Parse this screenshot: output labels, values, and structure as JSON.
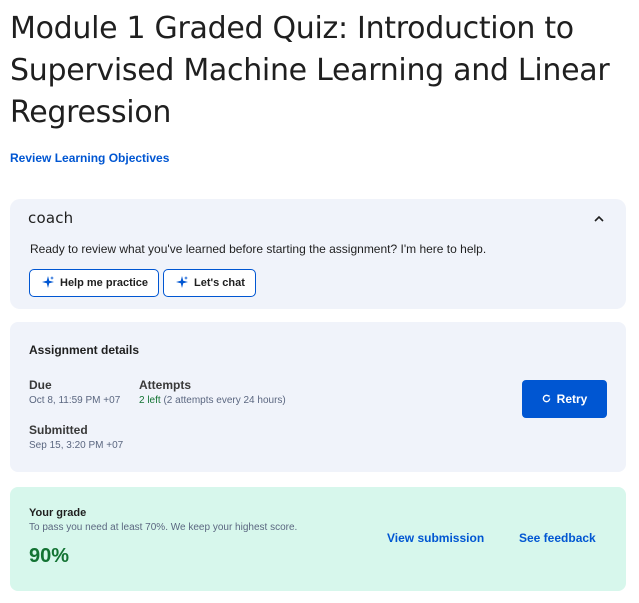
{
  "page": {
    "title": "Module 1 Graded Quiz: Introduction to Supervised Machine Learning and Linear Regression",
    "review_link": "Review Learning Objectives"
  },
  "coach": {
    "logo": "coach",
    "message": "Ready to review what you've learned before starting the assignment? I'm here to help.",
    "buttons": [
      {
        "label": "Help me practice",
        "icon": "sparkle-icon"
      },
      {
        "label": "Let's chat",
        "icon": "sparkle-icon"
      }
    ],
    "collapse_icon": "chevron-up-icon"
  },
  "assignment": {
    "heading": "Assignment details",
    "due_label": "Due",
    "due_value": "Oct 8, 11:59 PM +07",
    "attempts_label": "Attempts",
    "attempts_left": "2 left",
    "attempts_note": "(2 attempts every 24 hours)",
    "submitted_label": "Submitted",
    "submitted_value": "Sep 15, 3:20 PM +07",
    "retry_label": "Retry",
    "retry_icon": "refresh-icon"
  },
  "grade": {
    "heading": "Your grade",
    "note": "To pass you need at least 70%. We keep your highest score.",
    "value": "90%",
    "view_submission": "View submission",
    "see_feedback": "See feedback"
  },
  "colors": {
    "accent": "#0056d2",
    "success": "#137333",
    "card_bg": "#f0f3fa",
    "grade_bg": "#d7f7ec"
  }
}
